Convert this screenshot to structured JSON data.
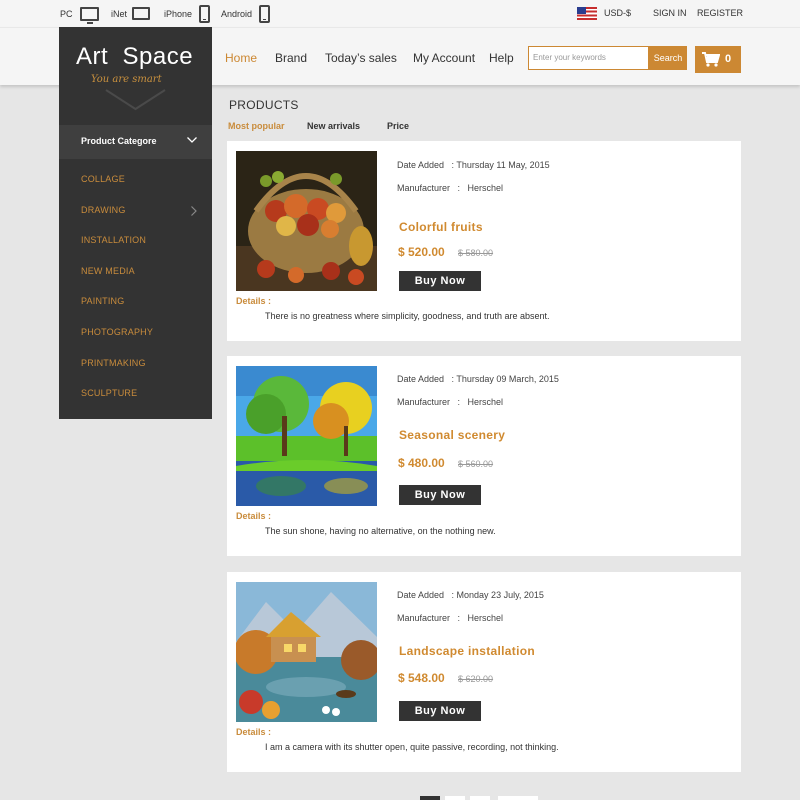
{
  "topbar": {
    "devices": [
      {
        "label": "PC",
        "icon": "monitor-icon"
      },
      {
        "label": "iNet",
        "icon": "tablet-icon"
      },
      {
        "label": "iPhone",
        "icon": "phone-icon"
      },
      {
        "label": "Android",
        "icon": "phone-icon"
      }
    ],
    "currency": "USD-$",
    "sign_in": "SIGN IN",
    "register": "REGISTER"
  },
  "logo": {
    "title": "Art  Space",
    "subtitle": "You are smart"
  },
  "nav": [
    "Home",
    "Brand",
    "Today’s sales",
    "My Account",
    "Help"
  ],
  "search": {
    "placeholder": "Enter your keywords",
    "button": "Search"
  },
  "cart": {
    "count": "0"
  },
  "sidebar": {
    "heading": "Product  Categore",
    "items": [
      "COLLAGE",
      "DRAWING",
      "INSTALLATION",
      "NEW MEDIA",
      "PAINTING",
      "PHOTOGRAPHY",
      "PRINTMAKING",
      "SCULPTURE"
    ]
  },
  "products": {
    "title": "PRODUCTS",
    "sort": [
      "Most popular",
      "New arrivals",
      "Price"
    ],
    "items": [
      {
        "date": "Date Added   : Thursday 11 May, 2015",
        "manufacturer": "Manufacturer   :   Herschel",
        "name": "Colorful fruits",
        "price": "$ 520.00",
        "old_price": "$ 580.00",
        "buy": "Buy  Now",
        "details_label": "Details :",
        "details": "There is no greatness where simplicity, goodness, and truth are absent."
      },
      {
        "date": "Date Added   : Thursday 09 March, 2015",
        "manufacturer": "Manufacturer   :   Herschel",
        "name": "Seasonal scenery",
        "price": "$ 480.00",
        "old_price": "$ 560.00",
        "buy": "Buy  Now",
        "details_label": "Details :",
        "details": "The sun shone, having no alternative, on the nothing new."
      },
      {
        "date": "Date Added   : Monday 23 July, 2015",
        "manufacturer": "Manufacturer   :   Herschel",
        "name": "Landscape installation",
        "price": "$ 548.00",
        "old_price": "$ 620.00",
        "buy": "Buy  Now",
        "details_label": "Details :",
        "details": "I am a camera with its shutter open, quite passive, recording, not thinking."
      }
    ]
  },
  "colors": {
    "accent": "#cc8833",
    "dark": "#333333",
    "background": "#e6e6e6"
  }
}
